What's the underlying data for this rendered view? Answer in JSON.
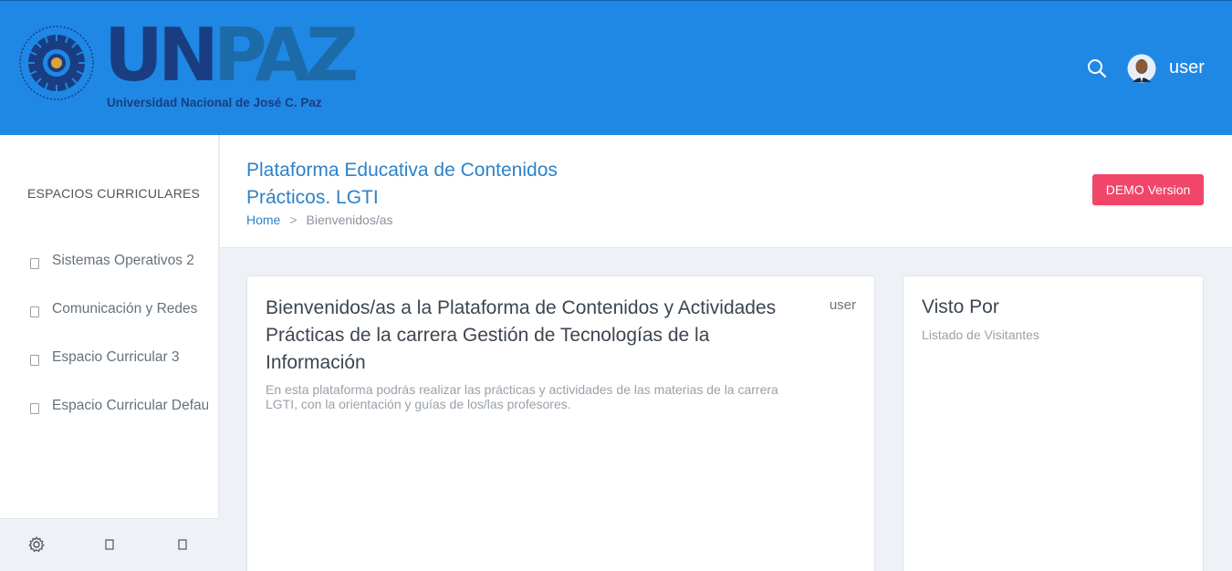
{
  "header": {
    "logo": {
      "word_un": "UN",
      "word_paz": "PAZ",
      "subtitle": "Universidad Nacional de José C. Paz"
    },
    "search_icon": "search-icon",
    "user_name": "user",
    "colors": {
      "header_bg": "#1f88e4",
      "logo_dark": "#1a3d82",
      "logo_mid": "#1c6aa8"
    }
  },
  "sidebar": {
    "title": "ESPACIOS CURRICULARES",
    "items": [
      {
        "label": "Sistemas Operativos 2"
      },
      {
        "label": "Comunicación y Redes"
      },
      {
        "label": "Espacio Curricular 3"
      },
      {
        "label": "Espacio Curricular Default"
      }
    ],
    "footer_icons": [
      "gear-icon",
      "square-icon",
      "square-icon"
    ]
  },
  "page": {
    "title": "Plataforma Educativa de Contenidos Prácticos. LGTI",
    "breadcrumb": {
      "home": "Home",
      "separator": ">",
      "current": "Bienvenidos/as"
    },
    "demo_label": "DEMO Version",
    "demo_color": "#f2456a"
  },
  "main_card": {
    "title": "Bienvenidos/as a la Plataforma de Contenidos y Actividades Prácticas de la carrera Gestión de Tecnologías de la Información",
    "user": "user",
    "text": "En esta plataforma podrás realizar las prácticas y actividades de las materias de la carrera LGTI, con la orientación y guías de los/las profesores."
  },
  "side_card": {
    "title": "Visto Por",
    "subtitle": "Listado de Visitantes"
  }
}
